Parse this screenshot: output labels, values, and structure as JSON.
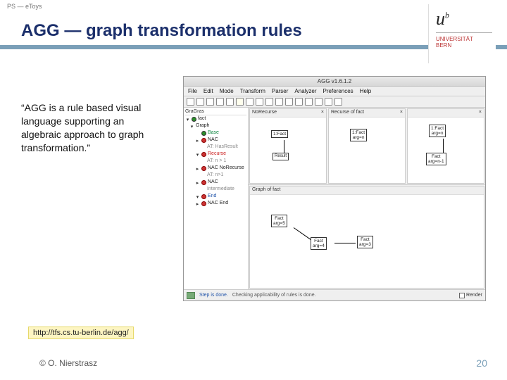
{
  "header": {
    "breadcrumb": "PS — eToys"
  },
  "title": "AGG — graph transformation rules",
  "logo": {
    "mark": "u",
    "sup": "b",
    "line1": "UNIVERSITÄT",
    "line2": "BERN"
  },
  "quote": "“AGG is a rule based visual language supporting an algebraic approach to graph transformation.”",
  "url": "http://tfs.cs.tu-berlin.de/agg/",
  "footer": {
    "copyright": "© O. Nierstrasz",
    "page": "20"
  },
  "app": {
    "window_title": "AGG  v1.6.1.2",
    "menu": [
      "File",
      "Edit",
      "Mode",
      "Transform",
      "Parser",
      "Analyzer",
      "Preferences",
      "Help"
    ],
    "tree": {
      "header": "GraGras",
      "rows": [
        {
          "indent": 0,
          "tw": "▾",
          "dot": "green",
          "text": "fact",
          "cls": ""
        },
        {
          "indent": 1,
          "tw": "▾",
          "dot": "",
          "text": "Graph",
          "cls": ""
        },
        {
          "indent": 2,
          "tw": "",
          "dot": "green",
          "text": "Base",
          "cls": "lbl-green"
        },
        {
          "indent": 2,
          "tw": "▸",
          "dot": "red",
          "text": "NAC",
          "cls": ""
        },
        {
          "indent": 3,
          "tw": "",
          "dot": "",
          "text": "AT:  HasResult",
          "cls": "lbl-gray"
        },
        {
          "indent": 2,
          "tw": "▾",
          "dot": "red",
          "text": "Recurse",
          "cls": "lbl-red"
        },
        {
          "indent": 3,
          "tw": "",
          "dot": "",
          "text": "AT:  n > 1",
          "cls": "lbl-gray"
        },
        {
          "indent": 2,
          "tw": "▸",
          "dot": "red",
          "text": "NAC  NoRecurse",
          "cls": ""
        },
        {
          "indent": 3,
          "tw": "",
          "dot": "",
          "text": "AT:  n>1",
          "cls": "lbl-gray"
        },
        {
          "indent": 2,
          "tw": "▸",
          "dot": "red",
          "text": "NAC",
          "cls": ""
        },
        {
          "indent": 3,
          "tw": "",
          "dot": "",
          "text": "Intermediate",
          "cls": "lbl-gray"
        },
        {
          "indent": 2,
          "tw": "▾",
          "dot": "red",
          "text": "End",
          "cls": "lbl-blue"
        },
        {
          "indent": 2,
          "tw": "▸",
          "dot": "red",
          "text": "NAC  End",
          "cls": ""
        }
      ]
    },
    "rule": {
      "nac": {
        "header": "NoRecurse",
        "node": "1:Fact"
      },
      "lhs": {
        "header": "Recurse of fact",
        "node_top": "1:Fact",
        "node_top_sub": "arg=n"
      },
      "rhs": {
        "node_top": "1:Fact",
        "node_top_sub": "arg=n",
        "node_bot": "Fact",
        "node_bot_sub": "arg=n-1"
      }
    },
    "graph": {
      "header": "Graph of fact",
      "n1": "Fact",
      "n1s": "arg=5",
      "n2": "Fact",
      "n2s": "arg=4",
      "n3": "Fact",
      "n3s": "arg=3"
    },
    "status": {
      "msg1": "Step is done.",
      "msg2": "Checking applicability of rules is done.",
      "checkbox": "Render"
    }
  }
}
